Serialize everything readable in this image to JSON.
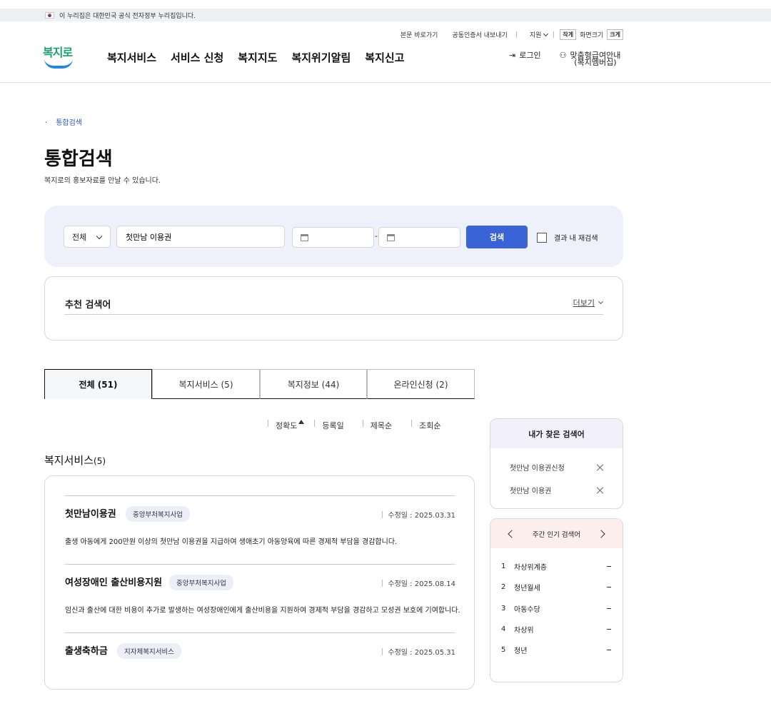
{
  "gov_banner": "이 누리집은 대한민국 공식 전자정부 누리집입니다.",
  "util": {
    "skip": "본문 바로가기",
    "cert": "공동인증서 내보내기",
    "lang": "지원",
    "small": "작게",
    "zoom": "화면크기",
    "large": "크게"
  },
  "logo": "복지로",
  "gnb": [
    "복지서비스",
    "서비스 신청",
    "복지지도",
    "복지위기알림",
    "복지신고"
  ],
  "header_right": {
    "login": "로그인",
    "guide_line1": "맞춤형급여안내",
    "guide_line2": "(복지멤버십)"
  },
  "breadcrumb": "통합검색",
  "page_title": "통합검색",
  "page_subtitle": "복지로의 홍보자료를 만날 수 있습니다.",
  "search": {
    "scope": "전체",
    "query": "첫만남 이용권",
    "date_sep": "-",
    "button": "검색",
    "research_label": "결과 내 재검색"
  },
  "reco": {
    "title": "추천 검색어",
    "more": "더보기"
  },
  "tabs": [
    "전체 (51)",
    "복지서비스 (5)",
    "복지정보 (44)",
    "온라인신청 (2)"
  ],
  "sort": [
    "정확도",
    "등록일",
    "제목순",
    "조회순"
  ],
  "section": {
    "title": "복지서비스",
    "count": "(5)"
  },
  "results": [
    {
      "title": "첫만남이용권",
      "tag": "중앙부처복지사업",
      "updated": "수정일 : 2025.03.31",
      "desc": "출생 아동에게 200만원 이상의 첫만남 이용권을 지급하여 생애초기 아동양육에 따른 경제적 부담을 경감합니다."
    },
    {
      "title": "여성장애인 출산비용지원",
      "tag": "중앙부처복지사업",
      "updated": "수정일 : 2025.08.14",
      "desc": "임신과 출산에 대한 비용이 추가로 발생하는 여성장애인에게 출산비용을 지원하여 경제적 부담을 경감하고 모성권 보호에 기여합니다."
    },
    {
      "title": "출생축하금",
      "tag": "지자체복지서비스",
      "updated": "수정일 : 2025.05.31",
      "desc": ""
    }
  ],
  "my_search": {
    "title": "내가 찾은 검색어",
    "items": [
      "첫만남 이용권신청",
      "첫만남 이용권"
    ]
  },
  "weekly": {
    "title": "주간 인기 검색어",
    "items": [
      {
        "rank": "1",
        "keyword": "차상위계층"
      },
      {
        "rank": "2",
        "keyword": "청년월세"
      },
      {
        "rank": "3",
        "keyword": "아동수당"
      },
      {
        "rank": "4",
        "keyword": "차상위"
      },
      {
        "rank": "5",
        "keyword": "청년"
      }
    ]
  }
}
